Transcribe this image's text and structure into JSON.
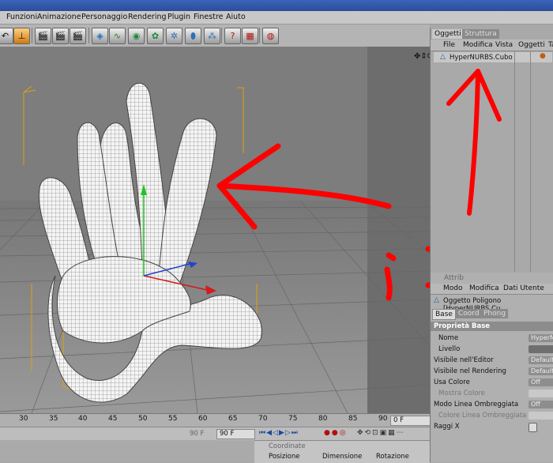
{
  "menu": [
    "Funzioni",
    "Animazione",
    "Personaggio",
    "Rendering",
    "Plugin",
    "Finestre",
    "Aiuto"
  ],
  "toolbar_icons": [
    "undo-icon",
    "move-icon",
    "film-clapper-icon",
    "film-clapper-icon",
    "film-clapper-icon",
    "cube-icon",
    "spline-icon",
    "nurbs-icon",
    "array-icon",
    "deformer-icon",
    "scene-icon",
    "particles-icon",
    "cursor-icon",
    "layout-icon",
    "render-icon"
  ],
  "viewport": {
    "nav_icons": "✥⇕⟳□"
  },
  "timeline": {
    "ticks": [
      "30",
      "35",
      "40",
      "45",
      "50",
      "55",
      "60",
      "65",
      "70",
      "75",
      "80",
      "85",
      "90"
    ],
    "current_frame": "0 F",
    "end_frame_left": "90 F",
    "end_frame": "90 F"
  },
  "coords": {
    "title": "Coordinate",
    "headers": [
      "Posizione",
      "Dimensione",
      "Rotazione"
    ]
  },
  "objects": {
    "tabs": [
      "Oggetti",
      "Struttura"
    ],
    "menu": [
      "File",
      "Modifica",
      "Vista",
      "Oggetti",
      "Ta"
    ],
    "items": [
      {
        "name": "HyperNURBS.Cubo"
      }
    ]
  },
  "attributes": {
    "tab": "Attrib",
    "menu": [
      "Modo",
      "Modifica",
      "Dati Utente"
    ],
    "object_title": "Oggetto Poligono [HyperNURBS.Cu",
    "subtabs": [
      "Base",
      "Coord",
      "Phong"
    ],
    "section": "Proprietà Base",
    "props": [
      {
        "label": "Nome",
        "value": "HyperN"
      },
      {
        "label": "Livello",
        "value": ""
      },
      {
        "label": "Visibile nell'Editor",
        "value": "Default"
      },
      {
        "label": "Visibile nel Rendering",
        "value": "Default"
      },
      {
        "label": "Usa Colore",
        "value": "Off"
      },
      {
        "label": "Mostra Colore",
        "value": ""
      },
      {
        "label": "Modo Linea Ombreggiata",
        "value": "Off"
      },
      {
        "label": "Colore Linea Ombreggiata",
        "value": ""
      },
      {
        "label": "Raggi X",
        "value": ""
      }
    ]
  },
  "annotations": {
    "smiley": ";-)"
  }
}
